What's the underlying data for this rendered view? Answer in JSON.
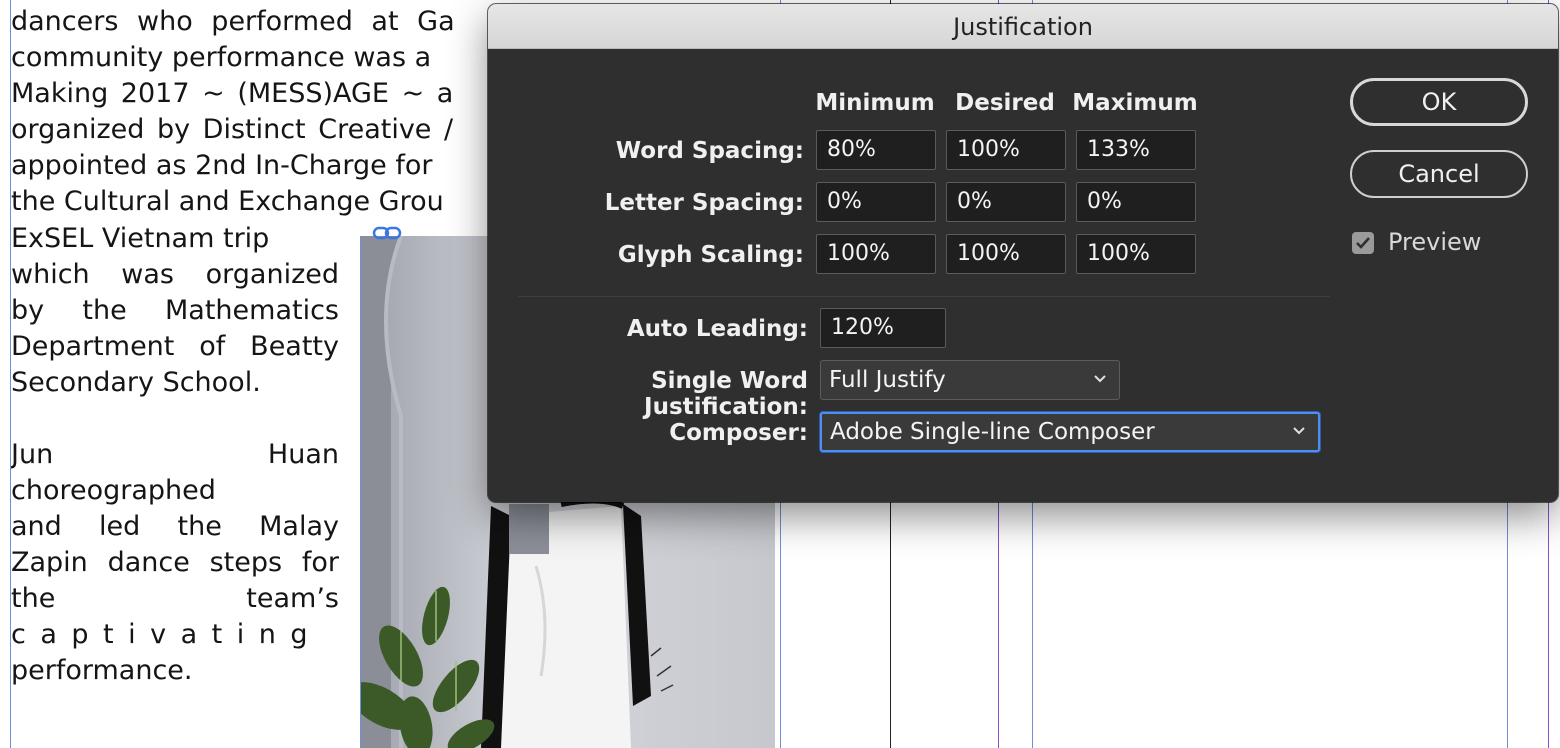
{
  "document": {
    "top_text_lines": [
      "dancers who performed at Ga",
      "community performance was a",
      "Making 2017 ~ (MESS)AGE ~ a",
      "organized by Distinct Creative /",
      "appointed as 2nd In-Charge for",
      "the Cultural and Exchange Grou"
    ],
    "column_lines_1": [
      "ExSEL Vietnam trip",
      "which was organized",
      "by the Mathematics",
      "Department of Beatty",
      "Secondary School."
    ],
    "column_lines_2": [
      "Jun Huan",
      "choreographed",
      "and led the Malay",
      "Zapin dance steps for",
      "the team’s",
      "captivating",
      "performance."
    ]
  },
  "dialog": {
    "title": "Justification",
    "columns": [
      "Minimum",
      "Desired",
      "Maximum"
    ],
    "rows": [
      {
        "label": "Word Spacing:",
        "values": [
          "80%",
          "100%",
          "133%"
        ]
      },
      {
        "label": "Letter Spacing:",
        "values": [
          "0%",
          "0%",
          "0%"
        ]
      },
      {
        "label": "Glyph Scaling:",
        "values": [
          "100%",
          "100%",
          "100%"
        ]
      }
    ],
    "auto_leading": {
      "label": "Auto Leading:",
      "value": "120%"
    },
    "single_word": {
      "label": "Single Word Justification:",
      "value": "Full Justify"
    },
    "composer": {
      "label": "Composer:",
      "value": "Adobe Single-line Composer"
    },
    "ok_label": "OK",
    "cancel_label": "Cancel",
    "preview_label": "Preview",
    "preview_checked": true
  },
  "colors": {
    "dialog_bg": "#2f2f2f",
    "field_bg": "#1f1f1f",
    "focus_ring": "#4e8ff0",
    "guide_blue": "#6f8fd8",
    "guide_purple": "#8a4fd0"
  }
}
